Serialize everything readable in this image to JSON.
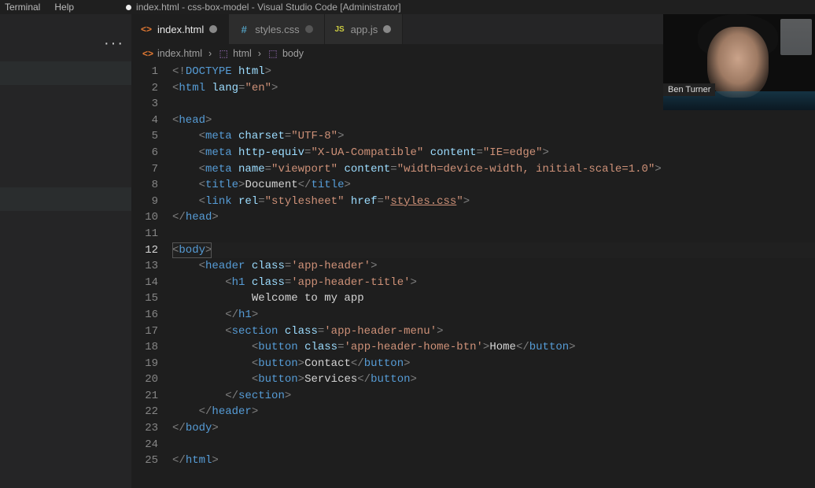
{
  "menubar": {
    "items": [
      "Terminal",
      "Help"
    ],
    "window_title": "index.html - css-box-model - Visual Studio Code [Administrator]",
    "title_dirty": true
  },
  "tabs": [
    {
      "label": "index.html",
      "icon": "<>",
      "iconClass": "ico-html",
      "active": true,
      "dirty": true
    },
    {
      "label": "styles.css",
      "icon": "#",
      "iconClass": "ico-css",
      "active": false,
      "dirty": false
    },
    {
      "label": "app.js",
      "icon": "JS",
      "iconClass": "ico-js",
      "active": false,
      "dirty": true
    }
  ],
  "breadcrumbs": [
    {
      "icon": "<>",
      "iconClass": "ico-html",
      "label": "index.html"
    },
    {
      "icon": "⬚",
      "iconClass": "crumb-cube",
      "label": "html"
    },
    {
      "icon": "⬚",
      "iconClass": "crumb-cube",
      "label": "body"
    }
  ],
  "webcam": {
    "name": "Ben Turner"
  },
  "active_line": 12,
  "code_lines": [
    {
      "n": 1,
      "segs": [
        {
          "t": "<!",
          "c": "pun"
        },
        {
          "t": "DOCTYPE",
          "c": "doctype"
        },
        {
          "t": " ",
          "c": "pun"
        },
        {
          "t": "html",
          "c": "attr"
        },
        {
          "t": ">",
          "c": "pun"
        }
      ]
    },
    {
      "n": 2,
      "segs": [
        {
          "t": "<",
          "c": "pun"
        },
        {
          "t": "html",
          "c": "tagn"
        },
        {
          "t": " ",
          "c": "text"
        },
        {
          "t": "lang",
          "c": "attr"
        },
        {
          "t": "=",
          "c": "pun"
        },
        {
          "t": "\"en\"",
          "c": "str"
        },
        {
          "t": ">",
          "c": "pun"
        }
      ]
    },
    {
      "n": 3,
      "segs": []
    },
    {
      "n": 4,
      "segs": [
        {
          "t": "<",
          "c": "pun"
        },
        {
          "t": "head",
          "c": "tagn"
        },
        {
          "t": ">",
          "c": "pun"
        }
      ]
    },
    {
      "n": 5,
      "segs": [
        {
          "t": "    ",
          "c": "text"
        },
        {
          "t": "<",
          "c": "pun"
        },
        {
          "t": "meta",
          "c": "tagn"
        },
        {
          "t": " ",
          "c": "text"
        },
        {
          "t": "charset",
          "c": "attr"
        },
        {
          "t": "=",
          "c": "pun"
        },
        {
          "t": "\"UTF-8\"",
          "c": "str"
        },
        {
          "t": ">",
          "c": "pun"
        }
      ]
    },
    {
      "n": 6,
      "segs": [
        {
          "t": "    ",
          "c": "text"
        },
        {
          "t": "<",
          "c": "pun"
        },
        {
          "t": "meta",
          "c": "tagn"
        },
        {
          "t": " ",
          "c": "text"
        },
        {
          "t": "http-equiv",
          "c": "attr"
        },
        {
          "t": "=",
          "c": "pun"
        },
        {
          "t": "\"X-UA-Compatible\"",
          "c": "str"
        },
        {
          "t": " ",
          "c": "text"
        },
        {
          "t": "content",
          "c": "attr"
        },
        {
          "t": "=",
          "c": "pun"
        },
        {
          "t": "\"IE=edge\"",
          "c": "str"
        },
        {
          "t": ">",
          "c": "pun"
        }
      ]
    },
    {
      "n": 7,
      "segs": [
        {
          "t": "    ",
          "c": "text"
        },
        {
          "t": "<",
          "c": "pun"
        },
        {
          "t": "meta",
          "c": "tagn"
        },
        {
          "t": " ",
          "c": "text"
        },
        {
          "t": "name",
          "c": "attr"
        },
        {
          "t": "=",
          "c": "pun"
        },
        {
          "t": "\"viewport\"",
          "c": "str"
        },
        {
          "t": " ",
          "c": "text"
        },
        {
          "t": "content",
          "c": "attr"
        },
        {
          "t": "=",
          "c": "pun"
        },
        {
          "t": "\"width=device-width, initial-scale=1.0\"",
          "c": "str"
        },
        {
          "t": ">",
          "c": "pun"
        }
      ]
    },
    {
      "n": 8,
      "segs": [
        {
          "t": "    ",
          "c": "text"
        },
        {
          "t": "<",
          "c": "pun"
        },
        {
          "t": "title",
          "c": "tagn"
        },
        {
          "t": ">",
          "c": "pun"
        },
        {
          "t": "Document",
          "c": "text"
        },
        {
          "t": "</",
          "c": "pun"
        },
        {
          "t": "title",
          "c": "tagn"
        },
        {
          "t": ">",
          "c": "pun"
        }
      ]
    },
    {
      "n": 9,
      "segs": [
        {
          "t": "    ",
          "c": "text"
        },
        {
          "t": "<",
          "c": "pun"
        },
        {
          "t": "link",
          "c": "tagn"
        },
        {
          "t": " ",
          "c": "text"
        },
        {
          "t": "rel",
          "c": "attr"
        },
        {
          "t": "=",
          "c": "pun"
        },
        {
          "t": "\"stylesheet\"",
          "c": "str"
        },
        {
          "t": " ",
          "c": "text"
        },
        {
          "t": "href",
          "c": "attr"
        },
        {
          "t": "=",
          "c": "pun"
        },
        {
          "t": "\"",
          "c": "str"
        },
        {
          "t": "styles.css",
          "c": "link"
        },
        {
          "t": "\"",
          "c": "str"
        },
        {
          "t": ">",
          "c": "pun"
        }
      ]
    },
    {
      "n": 10,
      "segs": [
        {
          "t": "</",
          "c": "pun"
        },
        {
          "t": "head",
          "c": "tagn"
        },
        {
          "t": ">",
          "c": "pun"
        }
      ]
    },
    {
      "n": 11,
      "segs": []
    },
    {
      "n": 12,
      "segs": [
        {
          "t": "<",
          "c": "pun",
          "sel": true
        },
        {
          "t": "body",
          "c": "tagn",
          "sel": true
        },
        {
          "t": ">",
          "c": "pun",
          "sel": true
        }
      ]
    },
    {
      "n": 13,
      "segs": [
        {
          "t": "    ",
          "c": "text"
        },
        {
          "t": "<",
          "c": "pun"
        },
        {
          "t": "header",
          "c": "tagn"
        },
        {
          "t": " ",
          "c": "text"
        },
        {
          "t": "class",
          "c": "attr"
        },
        {
          "t": "=",
          "c": "pun"
        },
        {
          "t": "'app-header'",
          "c": "str"
        },
        {
          "t": ">",
          "c": "pun"
        }
      ]
    },
    {
      "n": 14,
      "segs": [
        {
          "t": "        ",
          "c": "text"
        },
        {
          "t": "<",
          "c": "pun"
        },
        {
          "t": "h1",
          "c": "tagn"
        },
        {
          "t": " ",
          "c": "text"
        },
        {
          "t": "class",
          "c": "attr"
        },
        {
          "t": "=",
          "c": "pun"
        },
        {
          "t": "'app-header-title'",
          "c": "str"
        },
        {
          "t": ">",
          "c": "pun"
        }
      ]
    },
    {
      "n": 15,
      "segs": [
        {
          "t": "            Welcome to my app",
          "c": "text"
        }
      ]
    },
    {
      "n": 16,
      "segs": [
        {
          "t": "        ",
          "c": "text"
        },
        {
          "t": "</",
          "c": "pun"
        },
        {
          "t": "h1",
          "c": "tagn"
        },
        {
          "t": ">",
          "c": "pun"
        }
      ]
    },
    {
      "n": 17,
      "segs": [
        {
          "t": "        ",
          "c": "text"
        },
        {
          "t": "<",
          "c": "pun"
        },
        {
          "t": "section",
          "c": "tagn"
        },
        {
          "t": " ",
          "c": "text"
        },
        {
          "t": "class",
          "c": "attr"
        },
        {
          "t": "=",
          "c": "pun"
        },
        {
          "t": "'app-header-menu'",
          "c": "str"
        },
        {
          "t": ">",
          "c": "pun"
        }
      ]
    },
    {
      "n": 18,
      "segs": [
        {
          "t": "            ",
          "c": "text"
        },
        {
          "t": "<",
          "c": "pun"
        },
        {
          "t": "button",
          "c": "tagn"
        },
        {
          "t": " ",
          "c": "text"
        },
        {
          "t": "class",
          "c": "attr"
        },
        {
          "t": "=",
          "c": "pun"
        },
        {
          "t": "'app-header-home-btn'",
          "c": "str"
        },
        {
          "t": ">",
          "c": "pun"
        },
        {
          "t": "Home",
          "c": "text"
        },
        {
          "t": "</",
          "c": "pun"
        },
        {
          "t": "button",
          "c": "tagn"
        },
        {
          "t": ">",
          "c": "pun"
        }
      ]
    },
    {
      "n": 19,
      "segs": [
        {
          "t": "            ",
          "c": "text"
        },
        {
          "t": "<",
          "c": "pun"
        },
        {
          "t": "button",
          "c": "tagn"
        },
        {
          "t": ">",
          "c": "pun"
        },
        {
          "t": "Contact",
          "c": "text"
        },
        {
          "t": "</",
          "c": "pun"
        },
        {
          "t": "button",
          "c": "tagn"
        },
        {
          "t": ">",
          "c": "pun"
        }
      ]
    },
    {
      "n": 20,
      "segs": [
        {
          "t": "            ",
          "c": "text"
        },
        {
          "t": "<",
          "c": "pun"
        },
        {
          "t": "button",
          "c": "tagn"
        },
        {
          "t": ">",
          "c": "pun"
        },
        {
          "t": "Services",
          "c": "text"
        },
        {
          "t": "</",
          "c": "pun"
        },
        {
          "t": "button",
          "c": "tagn"
        },
        {
          "t": ">",
          "c": "pun"
        }
      ]
    },
    {
      "n": 21,
      "segs": [
        {
          "t": "        ",
          "c": "text"
        },
        {
          "t": "</",
          "c": "pun"
        },
        {
          "t": "section",
          "c": "tagn"
        },
        {
          "t": ">",
          "c": "pun"
        }
      ]
    },
    {
      "n": 22,
      "segs": [
        {
          "t": "    ",
          "c": "text"
        },
        {
          "t": "</",
          "c": "pun"
        },
        {
          "t": "header",
          "c": "tagn"
        },
        {
          "t": ">",
          "c": "pun"
        }
      ]
    },
    {
      "n": 23,
      "segs": [
        {
          "t": "</",
          "c": "pun"
        },
        {
          "t": "body",
          "c": "tagn"
        },
        {
          "t": ">",
          "c": "pun"
        }
      ]
    },
    {
      "n": 24,
      "segs": []
    },
    {
      "n": 25,
      "segs": [
        {
          "t": "</",
          "c": "pun"
        },
        {
          "t": "html",
          "c": "tagn"
        },
        {
          "t": ">",
          "c": "pun"
        }
      ]
    }
  ]
}
